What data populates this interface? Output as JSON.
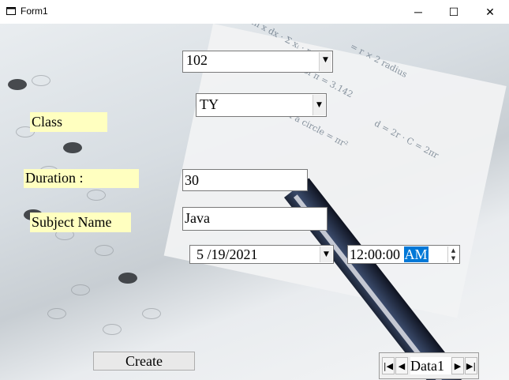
{
  "window": {
    "title": "Form1",
    "minimize": "─",
    "maximize": "☐",
    "close": "✕"
  },
  "form": {
    "id_combo_value": "102",
    "class_label": "Class",
    "class_combo_value": "TY",
    "duration_label": "Duration :",
    "duration_value": "30",
    "subject_label": "Subject Name",
    "subject_value": "Java",
    "date_value": "5 /19/2021",
    "time_value": "12:00:00 ",
    "time_ampm": "AM",
    "create_button": "Create"
  },
  "data_control": {
    "caption": "Data1",
    "first": "|◀",
    "prev": "◀",
    "next": "▶",
    "last": "▶|"
  },
  "icons": {
    "dropdown": "chevron-down-icon",
    "spin_up": "spin-up-icon",
    "spin_down": "spin-down-icon"
  },
  "colors": {
    "label_bg": "#ffffc0",
    "selection": "#0078d7"
  }
}
